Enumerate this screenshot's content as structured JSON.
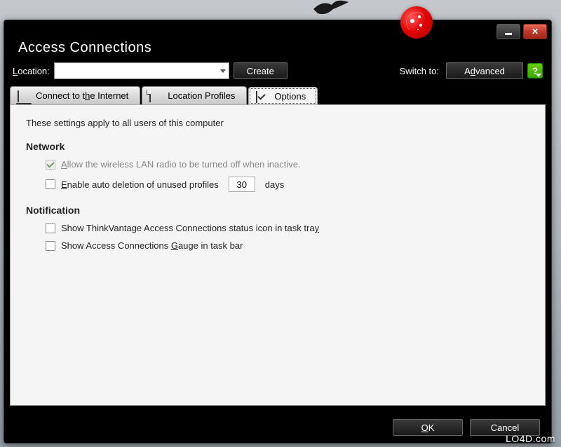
{
  "window": {
    "title": "Access Connections"
  },
  "toolbar": {
    "location_label": "Location:",
    "create_label": "Create",
    "switch_label": "Switch to:",
    "advanced_label": "Advanced"
  },
  "tabs": [
    {
      "label": "Connect to the Internet",
      "active": false
    },
    {
      "label": "Location Profiles",
      "active": false
    },
    {
      "label": "Options",
      "active": true
    }
  ],
  "options": {
    "intro": "These settings apply to all users of this computer",
    "network": {
      "heading": "Network",
      "allow_wlan_off": {
        "label": "Allow the wireless LAN radio to be turned off when inactive.",
        "checked": true,
        "disabled": true
      },
      "auto_delete": {
        "label": "Enable auto deletion of unused profiles",
        "checked": false,
        "days_value": "30",
        "days_suffix": "days"
      }
    },
    "notification": {
      "heading": "Notification",
      "status_icon": {
        "label": "Show ThinkVantage Access Connections status icon in task tray",
        "checked": false
      },
      "gauge": {
        "label": "Show Access Connections Gauge in task bar",
        "checked": false
      }
    }
  },
  "footer": {
    "ok_label": "OK",
    "cancel_label": "Cancel"
  },
  "watermark": "LO4D.com"
}
